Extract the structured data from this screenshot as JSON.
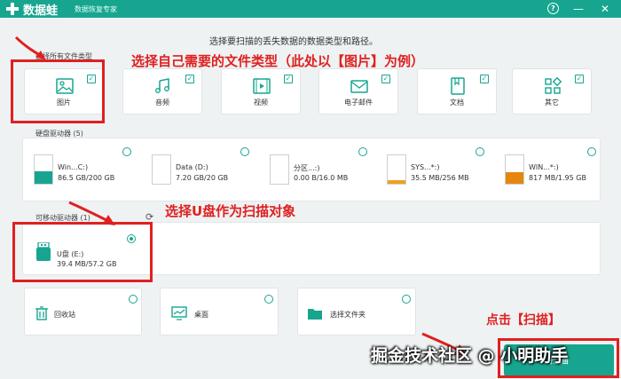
{
  "app": {
    "name": "数据蛙",
    "subtitle": "数据恢复专家",
    "help_glyph": "?",
    "min_glyph": "—",
    "close_glyph": "✕",
    "accent": "#17a590"
  },
  "instruction": "选择要扫描的丢失数据的数据类型和路径。",
  "select_all_label": "选择所有文件类型",
  "file_types": [
    {
      "label": "图片",
      "icon": "image-icon",
      "checked": true
    },
    {
      "label": "音频",
      "icon": "music-icon",
      "checked": true
    },
    {
      "label": "视频",
      "icon": "video-icon",
      "checked": true
    },
    {
      "label": "电子邮件",
      "icon": "email-icon",
      "checked": true
    },
    {
      "label": "文档",
      "icon": "document-icon",
      "checked": true
    },
    {
      "label": "其它",
      "icon": "other-icon",
      "checked": true
    }
  ],
  "hard_drives": {
    "title": "硬盘驱动器 (5)",
    "items": [
      {
        "name": "Win...C:)",
        "size": "86.5 GB/200 GB",
        "fill_fraction": 0.43,
        "fill_color": "#17a590"
      },
      {
        "name": "Data (D:)",
        "size": "7.20 GB/20 GB",
        "fill_fraction": 0.0,
        "fill_color": "#17a590"
      },
      {
        "name": "分区...:)",
        "size": "0.00 B/16.0 MB",
        "fill_fraction": 0.0,
        "fill_color": "#f0a020"
      },
      {
        "name": "SYS...*:)",
        "size": "35.5 MB/256 MB",
        "fill_fraction": 0.14,
        "fill_color": "#f0a020"
      },
      {
        "name": "WIN...*:)",
        "size": "817 MB/1.95 GB",
        "fill_fraction": 0.42,
        "fill_color": "#e6860f"
      }
    ]
  },
  "removable": {
    "title": "可移动驱动器 (1)",
    "refresh_glyph": "⟳",
    "items": [
      {
        "name": "U盘 (E:)",
        "size": "39.4 MB/57.2 GB",
        "selected": true
      }
    ]
  },
  "locations": [
    {
      "label": "回收站",
      "icon": "recycle-bin-icon"
    },
    {
      "label": "桌面",
      "icon": "desktop-icon"
    },
    {
      "label": "选择文件夹",
      "icon": "folder-icon"
    }
  ],
  "scan_button": "扫描",
  "annotations": {
    "file_type": "选择自己需要的文件类型（此处以【图片】为例）",
    "usb": "选择U盘作为扫描对象",
    "scan": "点击【扫描】"
  },
  "watermark": "掘金技术社区 @ 小明助手"
}
